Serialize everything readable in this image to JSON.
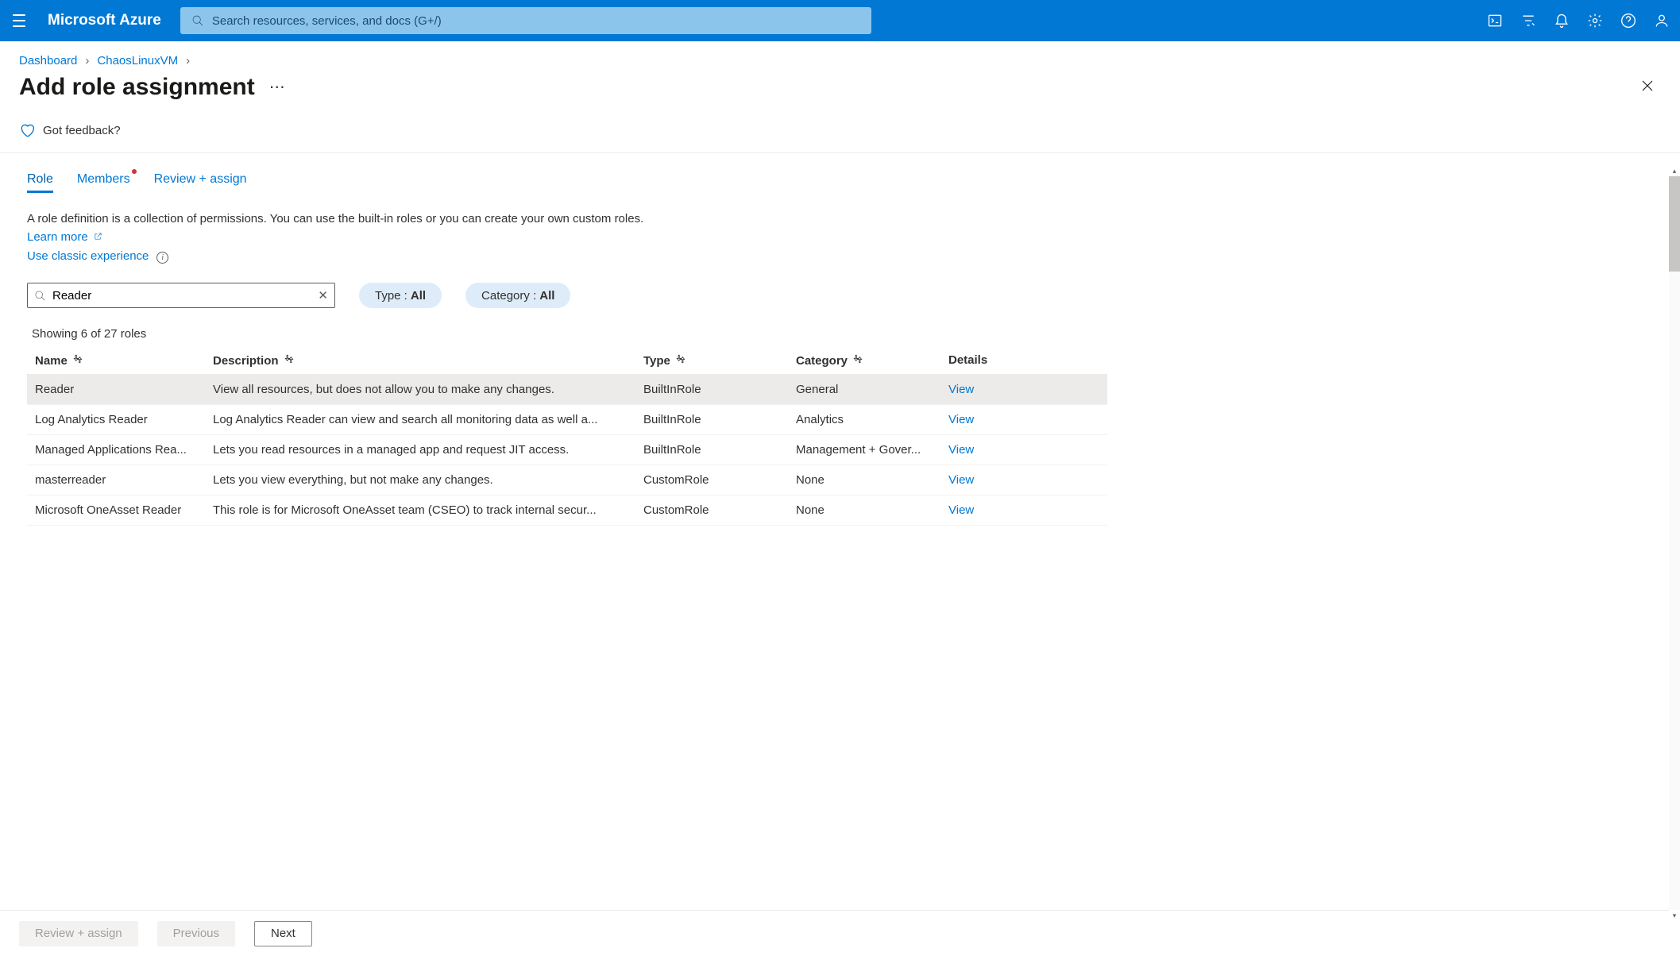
{
  "brand": "Microsoft Azure",
  "search": {
    "placeholder": "Search resources, services, and docs (G+/)"
  },
  "breadcrumb": {
    "items": [
      "Dashboard",
      "ChaosLinuxVM"
    ]
  },
  "page": {
    "title": "Add role assignment",
    "feedback": "Got feedback?"
  },
  "tabs": {
    "items": [
      "Role",
      "Members",
      "Review + assign"
    ],
    "active": 0,
    "dot_index": 1
  },
  "description": {
    "text": "A role definition is a collection of permissions. You can use the built-in roles or you can create your own custom roles. ",
    "learn_more": "Learn more",
    "classic": "Use classic experience"
  },
  "filter": {
    "search_value": "Reader",
    "pills": [
      {
        "label": "Type : ",
        "value": "All"
      },
      {
        "label": "Category : ",
        "value": "All"
      }
    ]
  },
  "result_count": "Showing 6 of 27 roles",
  "columns": [
    "Name",
    "Description",
    "Type",
    "Category",
    "Details"
  ],
  "rows": [
    {
      "name": "Reader",
      "description": "View all resources, but does not allow you to make any changes.",
      "type": "BuiltInRole",
      "category": "General",
      "selected": true
    },
    {
      "name": "Log Analytics Reader",
      "description": "Log Analytics Reader can view and search all monitoring data as well a...",
      "type": "BuiltInRole",
      "category": "Analytics",
      "selected": false
    },
    {
      "name": "Managed Applications Rea...",
      "description": "Lets you read resources in a managed app and request JIT access.",
      "type": "BuiltInRole",
      "category": "Management + Gover...",
      "selected": false
    },
    {
      "name": "masterreader",
      "description": "Lets you view everything, but not make any changes.",
      "type": "CustomRole",
      "category": "None",
      "selected": false
    },
    {
      "name": "Microsoft OneAsset Reader",
      "description": "This role is for Microsoft OneAsset team (CSEO) to track internal secur...",
      "type": "CustomRole",
      "category": "None",
      "selected": false
    }
  ],
  "view_label": "View",
  "footer": {
    "review": "Review + assign",
    "previous": "Previous",
    "next": "Next"
  }
}
